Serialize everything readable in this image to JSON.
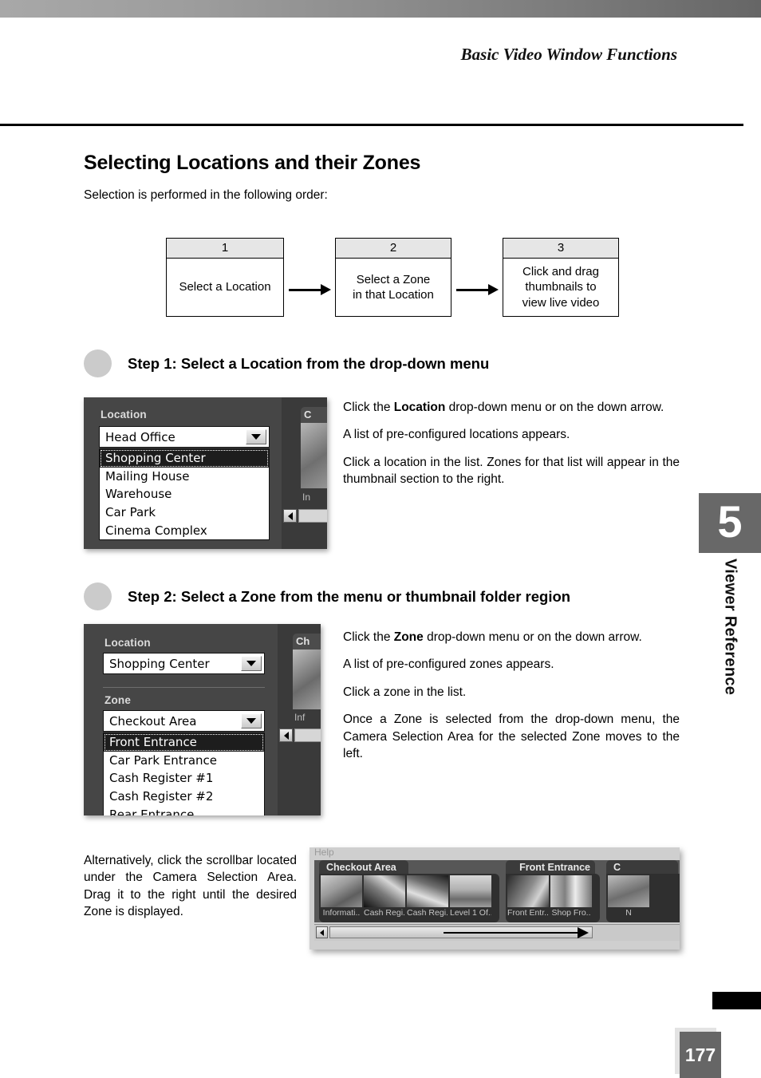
{
  "header": {
    "running_head": "Basic Video Window Functions"
  },
  "section": {
    "title": "Selecting Locations and their Zones",
    "lead": "Selection is performed in the following order:"
  },
  "flow": {
    "boxes": [
      {
        "number": "1",
        "text": "Select a Location"
      },
      {
        "number": "2",
        "text": "Select a Zone\nin that Location"
      },
      {
        "number": "3",
        "text": "Click and drag\nthumbnails to\nview live video"
      }
    ]
  },
  "step1": {
    "title": "Step 1: Select a Location from the drop-down menu",
    "screenshot": {
      "location_label": "Location",
      "location_value": "Head Office",
      "dropdown_options": [
        "Shopping Center",
        "Mailing House",
        "Warehouse",
        "Car Park",
        "Cinema Complex"
      ],
      "selected_option": "Shopping Center",
      "edge_tab_partial": "C",
      "edge_caption_partial": "In"
    },
    "copy": [
      {
        "pre": "Click the ",
        "bold": "Location",
        "post": " drop-down menu or on the down arrow."
      },
      {
        "pre": "A list of pre-configured locations appears.",
        "bold": "",
        "post": ""
      },
      {
        "pre": "Click a location in the list. Zones for that list will appear in the thumbnail section to the right.",
        "bold": "",
        "post": ""
      }
    ]
  },
  "step2": {
    "title": "Step 2: Select a Zone from the menu or thumbnail folder region",
    "screenshot": {
      "location_label": "Location",
      "location_value": "Shopping Center",
      "zone_label": "Zone",
      "zone_value": "Checkout Area",
      "dropdown_options": [
        "Front Entrance",
        "Car Park Entrance",
        "Cash Register #1",
        "Cash Register #2",
        "Rear Entrance"
      ],
      "selected_option": "Front Entrance",
      "edge_tab_partial": "Ch",
      "edge_caption_partial": "Inf"
    },
    "copy": [
      {
        "pre": "Click the ",
        "bold": "Zone",
        "post": " drop-down menu or on the down arrow."
      },
      {
        "pre": "A list of pre-configured zones appears.",
        "bold": "",
        "post": ""
      },
      {
        "pre": "Click a zone in the list.",
        "bold": "",
        "post": ""
      },
      {
        "pre": "Once a Zone is selected from the drop-down menu, the Camera Selection Area for the selected Zone moves to the left.",
        "bold": "",
        "post": ""
      }
    ]
  },
  "alternative": {
    "copy": "Alternatively, click the scrollbar located under the Camera Selection Area. Drag it to the right until the desired Zone is displayed."
  },
  "strip": {
    "help_label": "Help",
    "folders": [
      {
        "tab": "Checkout Area",
        "thumbnails": [
          {
            "caption": "Informati.."
          },
          {
            "caption": "Cash Regi.."
          },
          {
            "caption": "Cash Regi.."
          },
          {
            "caption": "Level 1 Of.."
          }
        ]
      },
      {
        "tab": "Front Entrance",
        "thumbnails": [
          {
            "caption": "Front Entr.."
          },
          {
            "caption": "Shop Fro.."
          }
        ]
      },
      {
        "tab": "C",
        "thumbnails": [
          {
            "caption": "N"
          }
        ]
      }
    ]
  },
  "chapter": {
    "number": "5",
    "label": "Viewer Reference"
  },
  "footer": {
    "page_number": "177"
  },
  "colors": {
    "panel_dark": "#464646",
    "chapter_tab": "#686868",
    "page_tab": "#666666",
    "flow_head": "#e6e6e6",
    "bullet": "#cbcbcb"
  }
}
